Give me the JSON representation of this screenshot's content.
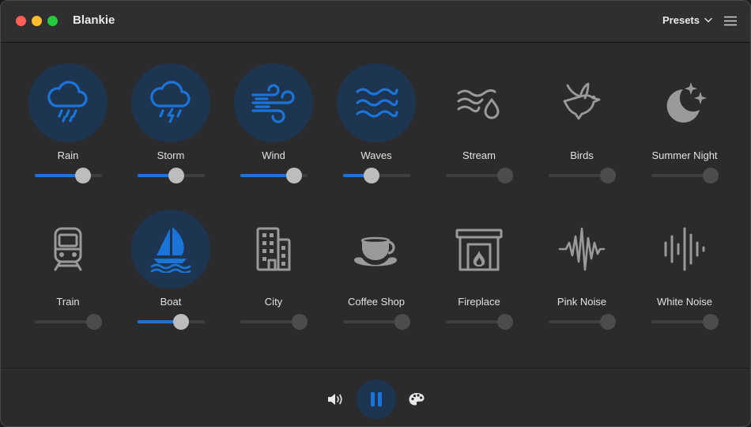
{
  "window": {
    "title": "Blankie"
  },
  "header": {
    "presets_label": "Presets"
  },
  "colors": {
    "accent": "#1b74d8",
    "active_bg": "#1d3550",
    "icon_inactive": "#9a9a9c"
  },
  "sounds": [
    {
      "label": "Rain",
      "icon": "cloud-rain-icon",
      "active": true,
      "volume": 0.72
    },
    {
      "label": "Storm",
      "icon": "cloud-bolt-rain-icon",
      "active": true,
      "volume": 0.58
    },
    {
      "label": "Wind",
      "icon": "wind-icon",
      "active": true,
      "volume": 0.8
    },
    {
      "label": "Waves",
      "icon": "water-waves-icon",
      "active": true,
      "volume": 0.42
    },
    {
      "label": "Stream",
      "icon": "stream-drop-icon",
      "active": false,
      "volume": 0.88
    },
    {
      "label": "Birds",
      "icon": "bird-icon",
      "active": false,
      "volume": 0.88
    },
    {
      "label": "Summer Night",
      "icon": "moon-stars-icon",
      "active": false,
      "volume": 0.88
    },
    {
      "label": "Train",
      "icon": "tram-icon",
      "active": false,
      "volume": 0.88
    },
    {
      "label": "Boat",
      "icon": "sailboat-icon",
      "active": true,
      "volume": 0.65
    },
    {
      "label": "City",
      "icon": "building-icon",
      "active": false,
      "volume": 0.88
    },
    {
      "label": "Coffee Shop",
      "icon": "cup-saucer-icon",
      "active": false,
      "volume": 0.88
    },
    {
      "label": "Fireplace",
      "icon": "fireplace-icon",
      "active": false,
      "volume": 0.88
    },
    {
      "label": "Pink Noise",
      "icon": "waveform-path-icon",
      "active": false,
      "volume": 0.88
    },
    {
      "label": "White Noise",
      "icon": "waveform-icon",
      "active": false,
      "volume": 0.88
    }
  ],
  "footer": {
    "volume_icon": "speaker-wave-icon",
    "playback_icon": "pause-icon",
    "theme_icon": "paint-palette-icon"
  }
}
